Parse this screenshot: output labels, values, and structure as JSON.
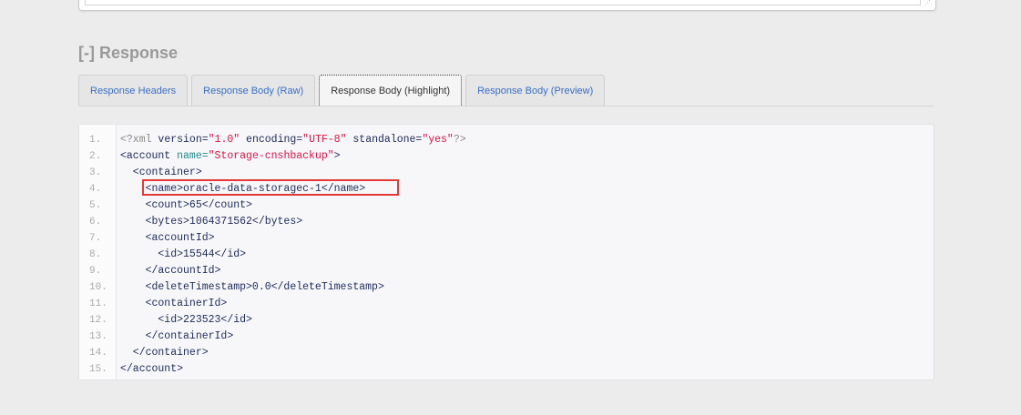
{
  "section": {
    "toggle": "[-]",
    "title": "Response"
  },
  "tabs": [
    {
      "label": "Response Headers",
      "active": false
    },
    {
      "label": "Response Body (Raw)",
      "active": false
    },
    {
      "label": "Response Body (Highlight)",
      "active": true
    },
    {
      "label": "Response Body (Preview)",
      "active": false
    }
  ],
  "code": {
    "line_numbers": [
      "1.",
      "2.",
      "3.",
      "4.",
      "5.",
      "6.",
      "7.",
      "8.",
      "9.",
      "10.",
      "11.",
      "12.",
      "13.",
      "14.",
      "15."
    ],
    "line1": {
      "open": "<?xml",
      "a1": " version=",
      "v1": "\"1.0\"",
      "a2": " encoding=",
      "v2": "\"UTF-8\"",
      "a3": " standalone=",
      "v3": "\"yes\"",
      "close": "?>"
    },
    "line2": {
      "open": "<account ",
      "attr": "name=",
      "val": "\"Storage-cnshbackup\"",
      "close": ">"
    },
    "lines": [
      "  <container>",
      "    <name>oracle-data-storagec-1</name>",
      "    <count>65</count>",
      "    <bytes>1064371562</bytes>",
      "    <accountId>",
      "      <id>15544</id>",
      "    </accountId>",
      "    <deleteTimestamp>0.0</deleteTimestamp>",
      "    <containerId>",
      "      <id>223523</id>",
      "    </containerId>",
      "  </container>",
      "</account>"
    ]
  },
  "colors": {
    "highlight_box": "#e53935",
    "tab_link": "#3a6fc4",
    "string": "#d14"
  },
  "icons": {
    "resize": "resize-handle-icon"
  }
}
